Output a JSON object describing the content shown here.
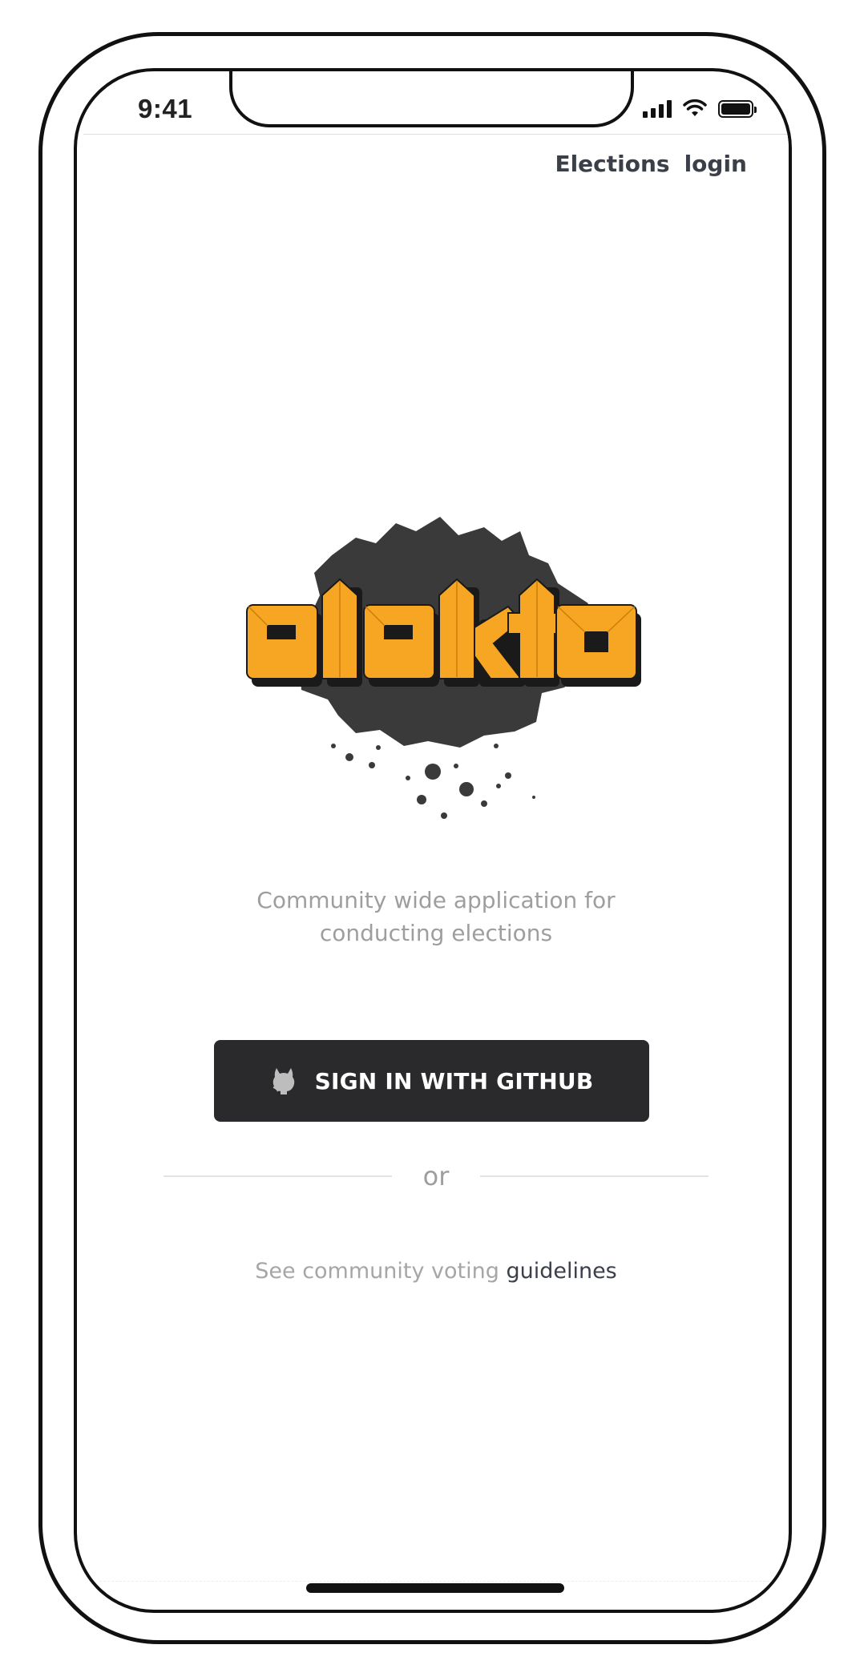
{
  "status_bar": {
    "time": "9:41",
    "signal_icon": "cellular-signal-icon",
    "wifi_icon": "wifi-icon",
    "battery_icon": "battery-icon"
  },
  "nav": {
    "elections_label": "Elections",
    "login_label": "login"
  },
  "logo": {
    "text": "elekto",
    "colors": {
      "splash": "#3a3a3a",
      "letters": "#f6a623",
      "letter_shadow": "#1a1a1a"
    }
  },
  "tagline": {
    "line1": "Community wide application for",
    "line2": "conducting elections"
  },
  "github_button": {
    "icon": "github-octocat-icon",
    "label": "SIGN IN WITH GITHUB",
    "bg_color": "#2a2a2c"
  },
  "divider": {
    "label": "or"
  },
  "guidelines": {
    "prefix": "See community voting",
    "link_label": "guidelines"
  },
  "colors": {
    "nav_text": "#3a3f4a",
    "muted_text": "#9e9e9e"
  }
}
